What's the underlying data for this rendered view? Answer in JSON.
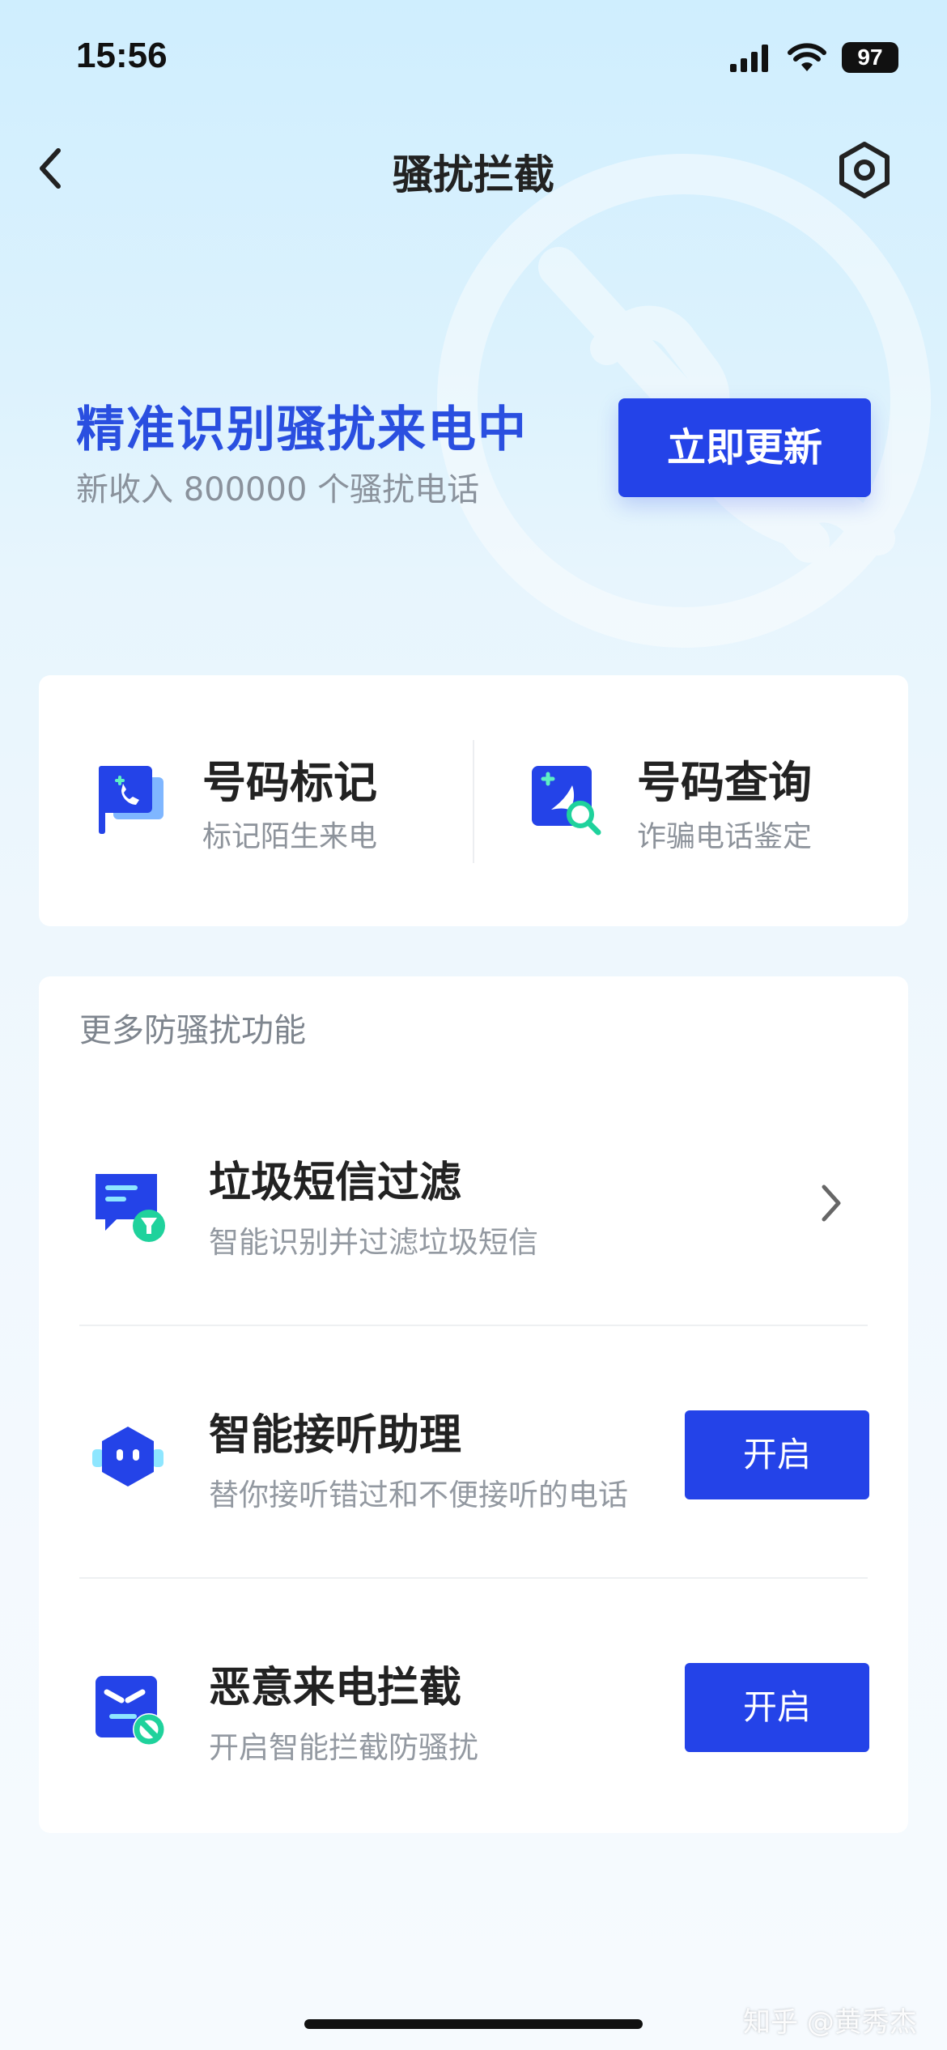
{
  "status_bar": {
    "time": "15:56",
    "battery": "97"
  },
  "nav": {
    "title": "骚扰拦截",
    "back_icon": "chevron-left-icon",
    "settings_icon": "hexagon-settings-icon"
  },
  "hero": {
    "title": "精准识别骚扰来电中",
    "subtitle": "新收入 800000 个骚扰电话",
    "update_button": "立即更新"
  },
  "quick_actions": [
    {
      "title": "号码标记",
      "subtitle": "标记陌生来电",
      "icon": "phone-flag-icon"
    },
    {
      "title": "号码查询",
      "subtitle": "诈骗电话鉴定",
      "icon": "number-search-icon"
    }
  ],
  "more": {
    "section_title": "更多防骚扰功能",
    "items": [
      {
        "title": "垃圾短信过滤",
        "subtitle": "智能识别并过滤垃圾短信",
        "icon": "sms-filter-icon",
        "action": "chevron"
      },
      {
        "title": "智能接听助理",
        "subtitle": "替你接听错过和不便接听的电话",
        "icon": "robot-assistant-icon",
        "action_label": "开启"
      },
      {
        "title": "恶意来电拦截",
        "subtitle": "开启智能拦截防骚扰",
        "icon": "block-call-icon",
        "action_label": "开启"
      }
    ]
  },
  "watermark": "知乎 @黄秀杰",
  "colors": {
    "accent": "#2443e8",
    "hero_title": "#2a4fe0",
    "card_bg": "#ffffff"
  }
}
